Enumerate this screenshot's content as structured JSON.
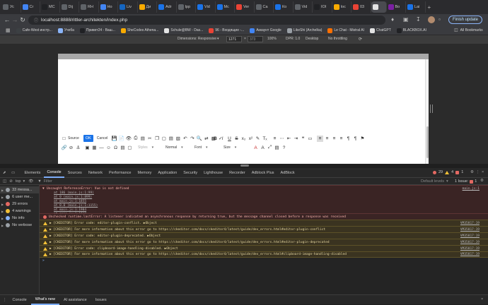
{
  "tabs": [
    {
      "label": "Ус",
      "color": "#5f6368"
    },
    {
      "label": "Cr",
      "color": "#4285f4"
    },
    {
      "label": "MC",
      "color": "#202124"
    },
    {
      "label": "Dij",
      "color": "#5f6368"
    },
    {
      "label": "RH",
      "color": "#5f6368"
    },
    {
      "label": "Ho",
      "color": "#4285f4"
    },
    {
      "label": "Liv",
      "color": "#1565c0"
    },
    {
      "label": "Ди",
      "color": "#f9ab00"
    },
    {
      "label": "Adr",
      "color": "#1a73e8"
    },
    {
      "label": "Ipp",
      "color": "#5f6368"
    },
    {
      "label": "Vid",
      "color": "#1a73e8"
    },
    {
      "label": "Mc",
      "color": "#1a73e8"
    },
    {
      "label": "Ver",
      "color": "#ea4335"
    },
    {
      "label": "Ca",
      "color": "#5f6368"
    },
    {
      "label": "Ко",
      "color": "#1a73e8"
    },
    {
      "label": "Vid",
      "color": "#5f6368"
    },
    {
      "label": "IOI",
      "color": "#202124"
    },
    {
      "label": "Іос",
      "color": "#f9ab00"
    },
    {
      "label": "03",
      "color": "#ea4335"
    },
    {
      "label": "",
      "color": "#e3e3e3",
      "active": true
    },
    {
      "label": "Bo",
      "color": "#7b1fa2"
    },
    {
      "label": "Lai",
      "color": "#1a73e8"
    }
  ],
  "address": {
    "url": "localhost:8888/rittler-architekten/index.php",
    "finish_label": "Finish update"
  },
  "bookmarks": [
    {
      "label": "Cafe-West инстр...",
      "color": "#3c4043"
    },
    {
      "label": "Учеба",
      "color": "#8ab4f8"
    },
    {
      "label": "Привет24 - Ваш...",
      "color": "#202124"
    },
    {
      "label": "SheCodes Athena...",
      "color": "#f9ab00"
    },
    {
      "label": "Schule@BW - Das...",
      "color": "#e3e3e3"
    },
    {
      "label": "96 - Входящие -...",
      "color": "#ea4335"
    },
    {
      "label": "Аккаунт Google",
      "color": "#4285f4"
    },
    {
      "label": "LikeShi (Archelka)",
      "color": "#9aa0a6"
    },
    {
      "label": "Le Chat - Mistral AI",
      "color": "#ff7000"
    },
    {
      "label": "ChatGPT",
      "color": "#e3e3e3"
    },
    {
      "label": "BLACKBOX.AI",
      "color": "#202124"
    }
  ],
  "all_bookmarks": "All Bookmarks",
  "device_toolbar": {
    "dimensions": "Dimensions: Responsive",
    "width": "1271",
    "height": "373",
    "zoom": "100%",
    "dpr": "DPR: 1.0",
    "device": "Desktop",
    "throttle": "No throttling"
  },
  "editor": {
    "source": "Source",
    "ok": "OK",
    "cancel": "Cancel",
    "styles": "Styles",
    "format": "Normal",
    "font": "Font",
    "size": "Size"
  },
  "devtools": {
    "tabs": [
      "Elements",
      "Console",
      "Sources",
      "Network",
      "Performance",
      "Memory",
      "Application",
      "Security",
      "Lighthouse",
      "Recorder",
      "Adblock Plus",
      "AdBlock"
    ],
    "active_tab": "Console",
    "errors_count": "29",
    "warnings_count": "4",
    "issues_count": "1",
    "context": "top",
    "filter_placeholder": "Filter",
    "levels": "Default levels",
    "issue_badge": "1 Issue:",
    "issue_count_badge": "1"
  },
  "sidebar": [
    {
      "label": "33 messa...",
      "color": "#9aa0a6"
    },
    {
      "label": "6 user me...",
      "color": "#9aa0a6"
    },
    {
      "label": "29 errors",
      "color": "#e46962"
    },
    {
      "label": "4 warnings",
      "color": "#f2c037"
    },
    {
      "label": "No info",
      "color": "#8ab4f8"
    },
    {
      "label": "No verbose",
      "color": "#9aa0a6"
    }
  ],
  "console": {
    "uncaught": "Uncaught ReferenceError: Vue is not defined",
    "uncaught_src": "main.js:1",
    "stack": [
      "at 186 (main.js:1:99)",
      "at 0 (main.js:1:899)",
      "at main.js:1:1855",
      "at 0.0 (main.js:1:1155)",
      "at main.js:1:1904",
      "at main.js:1:1910"
    ],
    "unchecked": "Unchecked runtime.lastError: A listener indicated an asynchronous response by returning true, but the message channel closed before a response was received",
    "w1": "[CKEDITOR] Error code: editor-plugin-conflict.  ▶Object",
    "w2": "[CKEDITOR] For more information about this error go to https://ckeditor.com/docs/ckeditor4/latest/guide/dev_errors.html#editor-plugin-conflict",
    "w3": "[CKEDITOR] Error code: editor-plugin-deprecated.  ▶Object",
    "w4": "[CKEDITOR] For more information about this error go to https://ckeditor.com/docs/ckeditor4/latest/guide/dev_errors.html#editor-plugin-deprecated",
    "w5": "[CKEDITOR] Error code: clipboard-image-handling-disabled.  ▶Object",
    "w6": "[CKEDITOR] For more information about this error go to https://ckeditor.com/docs/ckeditor4/latest/guide/dev_errors.html#clipboard-image-handling-disabled",
    "vm_src": "VM35817:19",
    "prompt": ">"
  },
  "drawer": {
    "tabs": [
      "Console",
      "What's new",
      "AI assistance",
      "Issues"
    ],
    "active": "What's new"
  }
}
